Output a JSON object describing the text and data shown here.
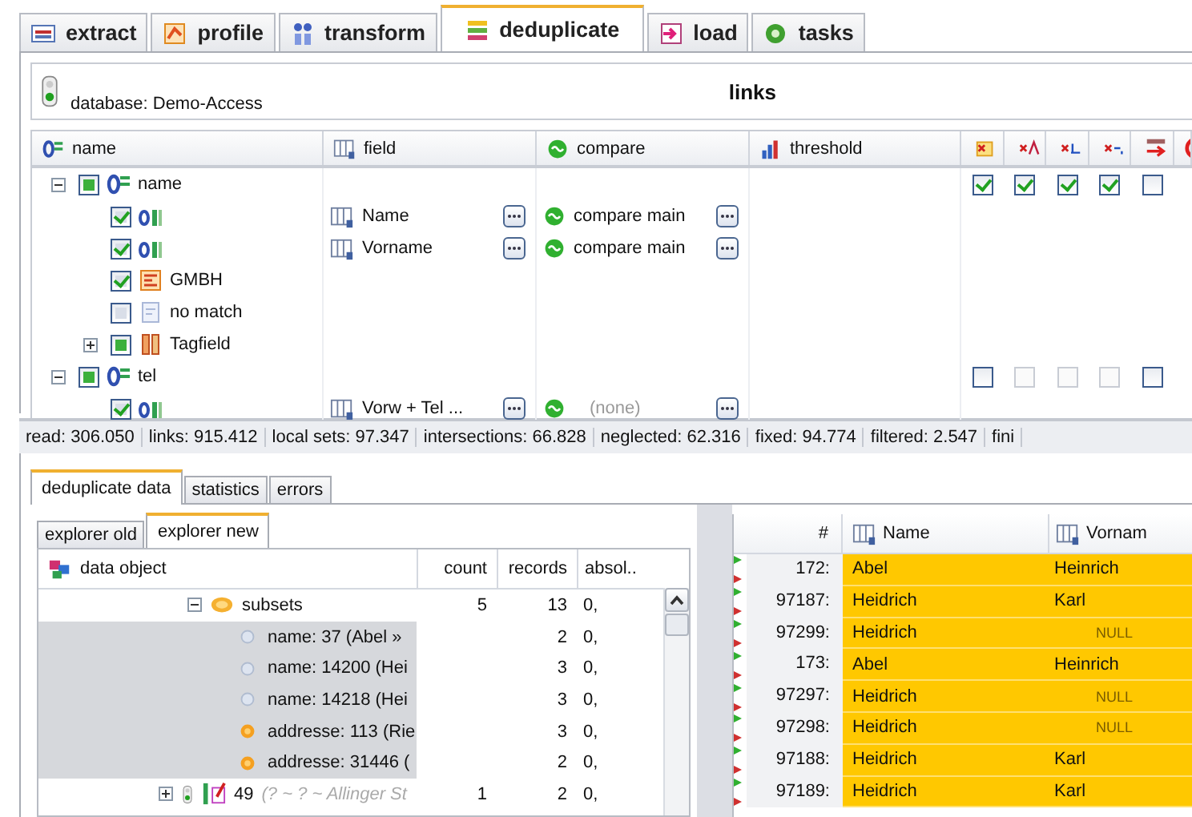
{
  "tabs": [
    {
      "label": "extract",
      "kind": "sql",
      "selected": false
    },
    {
      "label": "profile",
      "kind": "profile",
      "selected": false
    },
    {
      "label": "transform",
      "kind": "transform",
      "selected": false
    },
    {
      "label": "deduplicate",
      "kind": "dedup",
      "selected": true
    },
    {
      "label": "load",
      "kind": "load",
      "selected": false
    },
    {
      "label": "tasks",
      "kind": "tasks",
      "selected": false
    }
  ],
  "panel": {
    "database": "database: Demo-Access",
    "title": "links"
  },
  "links_table": {
    "columns": [
      "name",
      "field",
      "compare",
      "threshold"
    ],
    "rows": [
      {
        "label": "name",
        "kind": "group",
        "checked": false,
        "partial": true,
        "expanded": true,
        "flags": [
          {
            "checked": true,
            "disabled": false
          },
          {
            "checked": true,
            "disabled": false
          },
          {
            "checked": true,
            "disabled": false
          },
          {
            "checked": true,
            "disabled": false
          },
          {
            "checked": false,
            "disabled": false
          }
        ],
        "children": [
          {
            "kind": "pair",
            "checked": true,
            "partial": false,
            "field": "Name",
            "compare": "compare main",
            "compare_empty": false
          },
          {
            "kind": "pair",
            "checked": true,
            "partial": false,
            "field": "Vorname",
            "compare": "compare main",
            "compare_empty": false
          },
          {
            "label": "GMBH",
            "kind": "rule",
            "checked": true,
            "partial": false
          },
          {
            "label": "no match",
            "kind": "nomatch",
            "checked": false,
            "partial": false
          },
          {
            "label": "Tagfield",
            "kind": "tag",
            "checked": false,
            "partial": true,
            "expanded": false
          }
        ]
      },
      {
        "label": "tel",
        "kind": "group",
        "checked": false,
        "partial": true,
        "expanded": true,
        "flags": [
          {
            "checked": false,
            "disabled": false
          },
          {
            "checked": false,
            "disabled": true
          },
          {
            "checked": false,
            "disabled": true
          },
          {
            "checked": false,
            "disabled": true
          },
          {
            "checked": false,
            "disabled": false
          }
        ],
        "children": [
          {
            "kind": "pair",
            "checked": true,
            "partial": false,
            "field": "Vorw + Tel ...",
            "compare": "(none)",
            "compare_empty": true
          }
        ]
      }
    ]
  },
  "status_bar": [
    "read: 306.050",
    "links: 915.412",
    "local sets: 97.347",
    "intersections: 66.828",
    "neglected: 62.316",
    "fixed: 94.774",
    "filtered: 2.547",
    "fini"
  ],
  "lower_tabs": [
    {
      "label": "deduplicate data",
      "selected": true
    },
    {
      "label": "statistics",
      "selected": false
    },
    {
      "label": "errors",
      "selected": false
    }
  ],
  "explorer_tabs": [
    {
      "label": "explorer old",
      "selected": false
    },
    {
      "label": "explorer new",
      "selected": true
    }
  ],
  "explorer": {
    "columns": [
      "data object",
      "count",
      "records",
      "absol.."
    ],
    "rows": [
      {
        "kind": "subsets",
        "label": "subsets",
        "expanded": true,
        "count": "5",
        "records": "13",
        "absol": "0,",
        "selected": false,
        "children": [
          {
            "kind": "name",
            "label": "name: 37  (Abel »",
            "records": "2",
            "absol": "0,",
            "selected": true
          },
          {
            "kind": "name",
            "label": "name: 14200  (Hei",
            "records": "3",
            "absol": "0,",
            "selected": true
          },
          {
            "kind": "name",
            "label": "name: 14218  (Hei",
            "records": "3",
            "absol": "0,",
            "selected": true
          },
          {
            "kind": "address",
            "label": "addresse: 113  (Rie",
            "records": "3",
            "absol": "0,",
            "selected": true
          },
          {
            "kind": "address",
            "label": "addresse: 31446  (",
            "records": "2",
            "absol": "0,",
            "selected": true
          }
        ]
      },
      {
        "kind": "record",
        "label": "49",
        "detail": "(? ~ ? ~ Allinger St",
        "expanded": false,
        "count": "1",
        "records": "2",
        "absol": "0,",
        "selected": false
      }
    ]
  },
  "records": {
    "columns": [
      "#",
      "Name",
      "Vornam"
    ],
    "rows": [
      {
        "num": "172:",
        "name": "Abel",
        "vorname": "Heinrich",
        "vorname_null": false
      },
      {
        "num": "97187:",
        "name": "Heidrich",
        "vorname": "Karl",
        "vorname_null": false
      },
      {
        "num": "97299:",
        "name": "Heidrich",
        "vorname": "NULL",
        "vorname_null": true
      },
      {
        "num": "173:",
        "name": "Abel",
        "vorname": "Heinrich",
        "vorname_null": false
      },
      {
        "num": "97297:",
        "name": "Heidrich",
        "vorname": "NULL",
        "vorname_null": true
      },
      {
        "num": "97298:",
        "name": "Heidrich",
        "vorname": "NULL",
        "vorname_null": true
      },
      {
        "num": "97188:",
        "name": "Heidrich",
        "vorname": "Karl",
        "vorname_null": false
      },
      {
        "num": "97189:",
        "name": "Heidrich",
        "vorname": "Karl",
        "vorname_null": false
      }
    ]
  }
}
